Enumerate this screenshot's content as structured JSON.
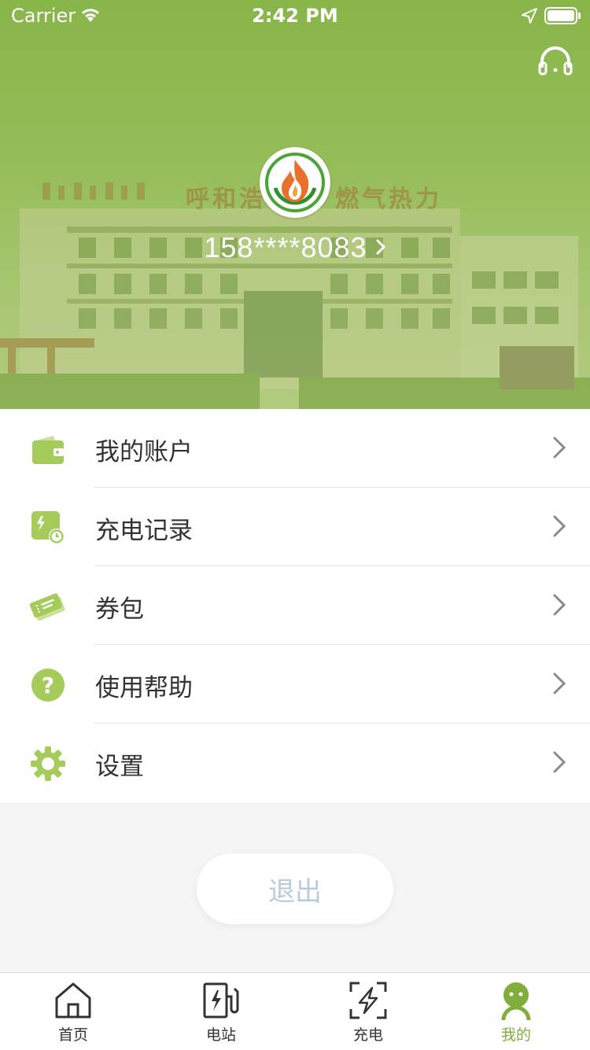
{
  "status_bar": {
    "carrier": "Carrier",
    "time": "2:42 PM"
  },
  "header": {
    "sign_left": "呼和浩",
    "sign_right": "燃气热力",
    "phone": "158****8083",
    "headset_icon": "headset-icon",
    "logo_icon": "flame-logo-icon"
  },
  "menu": [
    {
      "label": "我的账户",
      "icon": "wallet-icon"
    },
    {
      "label": "充电记录",
      "icon": "charge-record-icon"
    },
    {
      "label": "券包",
      "icon": "coupon-icon"
    },
    {
      "label": "使用帮助",
      "icon": "help-icon"
    },
    {
      "label": "设置",
      "icon": "gear-icon"
    }
  ],
  "logout_label": "退出",
  "tabs": [
    {
      "label": "首页",
      "icon": "home-icon"
    },
    {
      "label": "电站",
      "icon": "charging-station-icon"
    },
    {
      "label": "充电",
      "icon": "charge-scan-icon"
    },
    {
      "label": "我的",
      "icon": "profile-icon"
    }
  ],
  "colors": {
    "accent": "#7fae3b",
    "header_green": "#8ab84d",
    "icon_green": "#a5cc5a",
    "logout_text": "#b8cbe0"
  }
}
